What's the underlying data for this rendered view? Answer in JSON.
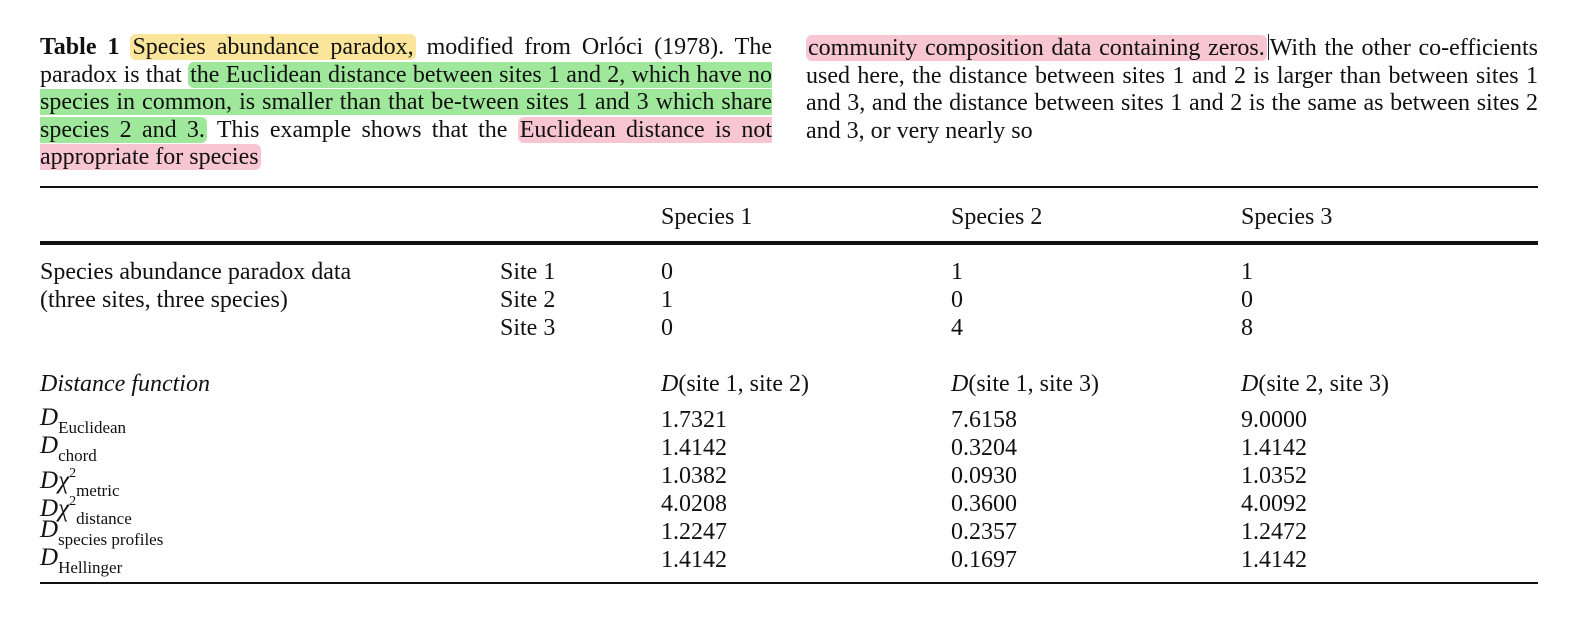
{
  "caption": {
    "label": "Table 1",
    "left_segments": [
      {
        "text": "Species abundance paradox,",
        "hl": "y"
      },
      {
        "text": " modified from Orlóci (1978). The paradox is that ",
        "hl": ""
      },
      {
        "text": "the Euclidean distance between sites 1 and 2, which have no species in common, is smaller than that be-tween sites 1 and 3 which share species 2 and 3.",
        "hl": "g"
      },
      {
        "text": " This example shows that the ",
        "hl": ""
      },
      {
        "text": "Euclidean distance is not appropriate for species",
        "hl": "p"
      }
    ],
    "right_segments": [
      {
        "text": "community composition data containing zeros.",
        "hl": "p"
      },
      {
        "text": "With the other co-efficients used here, the distance between sites 1 and 2 is larger than between sites 1 and 3, and the distance between sites 1 and 2 is the same as between sites 2 and 3, or very nearly so",
        "hl": ""
      }
    ]
  },
  "table": {
    "species_headers": [
      "Species 1",
      "Species 2",
      "Species 3"
    ],
    "data_label_line1": "Species abundance paradox data",
    "data_label_line2": "(three sites, three species)",
    "sites": [
      {
        "name": "Site 1",
        "values": [
          "0",
          "1",
          "1"
        ]
      },
      {
        "name": "Site 2",
        "values": [
          "1",
          "0",
          "0"
        ]
      },
      {
        "name": "Site 3",
        "values": [
          "0",
          "4",
          "8"
        ]
      }
    ],
    "distance_header": "Distance function",
    "pair_headers": [
      {
        "D": "D",
        "rest": "(site 1, site 2)"
      },
      {
        "D": "D",
        "rest": "(site 1, site 3)"
      },
      {
        "D": "D",
        "rest": "(site 2, site 3)"
      }
    ],
    "distances": [
      {
        "D": "D",
        "chi": "",
        "sup": "",
        "sub": "Euclidean",
        "values": [
          "1.7321",
          "7.6158",
          "9.0000"
        ]
      },
      {
        "D": "D",
        "chi": "",
        "sup": "",
        "sub": "chord",
        "values": [
          "1.4142",
          "0.3204",
          "1.4142"
        ]
      },
      {
        "D": "D",
        "chi": "χ",
        "sup": "2",
        "sub": "metric",
        "values": [
          "1.0382",
          "0.0930",
          "1.0352"
        ]
      },
      {
        "D": "D",
        "chi": "χ",
        "sup": "2",
        "sub": "distance",
        "values": [
          "4.0208",
          "0.3600",
          "4.0092"
        ]
      },
      {
        "D": "D",
        "chi": "",
        "sup": "",
        "sub": "species profiles",
        "values": [
          "1.2247",
          "0.2357",
          "1.2472"
        ]
      },
      {
        "D": "D",
        "chi": "",
        "sup": "",
        "sub": "Hellinger",
        "values": [
          "1.4142",
          "0.1697",
          "1.4142"
        ]
      }
    ]
  },
  "colors": {
    "highlight_yellow": "#fbe59a",
    "highlight_green": "#9fe79a",
    "highlight_pink": "#f8c6d3"
  }
}
